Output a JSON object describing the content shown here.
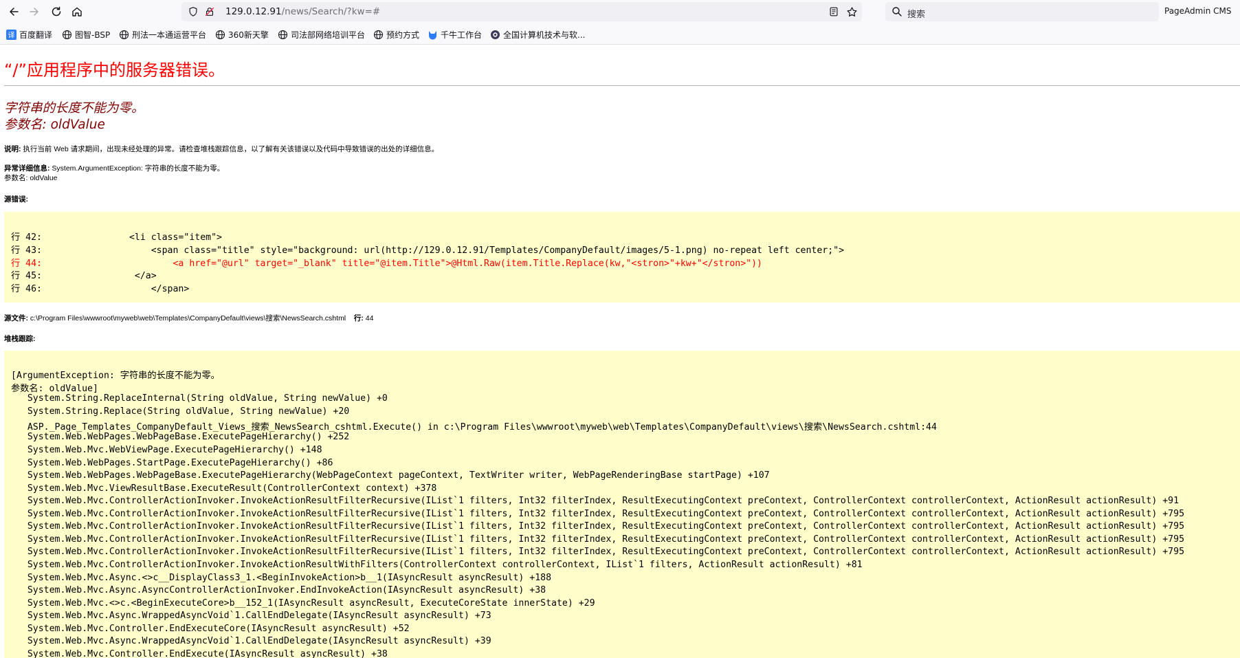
{
  "browser": {
    "url_host": "129.0.12.91",
    "url_path": "/news/Search/?kw=#",
    "search_placeholder": "搜索",
    "extension_label": "PageAdmin CMS"
  },
  "bookmarks": [
    {
      "label": "百度翻译",
      "icon": "translate-icon"
    },
    {
      "label": "图智-BSP",
      "icon": "globe-icon"
    },
    {
      "label": "刑法一本通运营平台",
      "icon": "globe-icon"
    },
    {
      "label": "360新天擎",
      "icon": "globe-icon"
    },
    {
      "label": "司法部网络培训平台",
      "icon": "globe-icon"
    },
    {
      "label": "预约方式",
      "icon": "globe-icon"
    },
    {
      "label": "千牛工作台",
      "icon": "qianniu-icon"
    },
    {
      "label": "全国计算机技术与软...",
      "icon": "eye-icon"
    }
  ],
  "page": {
    "title": "“/”应用程序中的服务器错误。",
    "message_line1": "字符串的长度不能为零。",
    "message_line2": "参数名: oldValue",
    "description_label": "说明:",
    "description_text": " 执行当前 Web 请求期间，出现未经处理的异常。请检查堆栈跟踪信息，以了解有关该错误以及代码中导致错误的出处的详细信息。",
    "exception_label": "异常详细信息:",
    "exception_text": " System.ArgumentException: 字符串的长度不能为零。",
    "exception_param": "参数名: oldValue",
    "source_error_label": "源错误:",
    "source_lines": [
      {
        "text": "行 42:                <li class=\"item\">",
        "highlight": false
      },
      {
        "text": "行 43:                    <span class=\"title\" style=\"background: url(http://129.0.12.91/Templates/CompanyDefault/images/5-1.png) no-repeat left center;\">",
        "highlight": false
      },
      {
        "text": "行 44:                        <a href=\"@url\" target=\"_blank\" title=\"@item.Title\">@Html.Raw(item.Title.Replace(kw,\"<stron>\"+kw+\"</stron>\"))",
        "highlight": true
      },
      {
        "text": "行 45:                 </a>",
        "highlight": false
      },
      {
        "text": "行 46:                    </span>",
        "highlight": false
      }
    ],
    "source_file_label": "源文件:",
    "source_file_path": " c:\\Program Files\\wwwroot\\myweb\\web\\Templates\\CompanyDefault\\views\\搜索\\NewsSearch.cshtml",
    "line_label": "行:",
    "line_value": " 44",
    "stack_label": "堆栈跟踪:",
    "stack_lines": [
      "[ArgumentException: 字符串的长度不能为零。",
      "参数名: oldValue]",
      "   System.String.ReplaceInternal(String oldValue, String newValue) +0",
      "   System.String.Replace(String oldValue, String newValue) +20",
      "   ASP._Page_Templates_CompanyDefault_Views_搜索_NewsSearch_cshtml.Execute() in c:\\Program Files\\wwwroot\\myweb\\web\\Templates\\CompanyDefault\\views\\搜索\\NewsSearch.cshtml:44",
      "   System.Web.WebPages.WebPageBase.ExecutePageHierarchy() +252",
      "   System.Web.Mvc.WebViewPage.ExecutePageHierarchy() +148",
      "   System.Web.WebPages.StartPage.ExecutePageHierarchy() +86",
      "   System.Web.WebPages.WebPageBase.ExecutePageHierarchy(WebPageContext pageContext, TextWriter writer, WebPageRenderingBase startPage) +107",
      "   System.Web.Mvc.ViewResultBase.ExecuteResult(ControllerContext context) +378",
      "   System.Web.Mvc.ControllerActionInvoker.InvokeActionResultFilterRecursive(IList`1 filters, Int32 filterIndex, ResultExecutingContext preContext, ControllerContext controllerContext, ActionResult actionResult) +91",
      "   System.Web.Mvc.ControllerActionInvoker.InvokeActionResultFilterRecursive(IList`1 filters, Int32 filterIndex, ResultExecutingContext preContext, ControllerContext controllerContext, ActionResult actionResult) +795",
      "   System.Web.Mvc.ControllerActionInvoker.InvokeActionResultFilterRecursive(IList`1 filters, Int32 filterIndex, ResultExecutingContext preContext, ControllerContext controllerContext, ActionResult actionResult) +795",
      "   System.Web.Mvc.ControllerActionInvoker.InvokeActionResultFilterRecursive(IList`1 filters, Int32 filterIndex, ResultExecutingContext preContext, ControllerContext controllerContext, ActionResult actionResult) +795",
      "   System.Web.Mvc.ControllerActionInvoker.InvokeActionResultFilterRecursive(IList`1 filters, Int32 filterIndex, ResultExecutingContext preContext, ControllerContext controllerContext, ActionResult actionResult) +795",
      "   System.Web.Mvc.ControllerActionInvoker.InvokeActionResultWithFilters(ControllerContext controllerContext, IList`1 filters, ActionResult actionResult) +81",
      "   System.Web.Mvc.Async.<>c__DisplayClass3_1.<BeginInvokeAction>b__1(IAsyncResult asyncResult) +188",
      "   System.Web.Mvc.Async.AsyncControllerActionInvoker.EndInvokeAction(IAsyncResult asyncResult) +38",
      "   System.Web.Mvc.<>c.<BeginExecuteCore>b__152_1(IAsyncResult asyncResult, ExecuteCoreState innerState) +29",
      "   System.Web.Mvc.Async.WrappedAsyncVoid`1.CallEndDelegate(IAsyncResult asyncResult) +73",
      "   System.Web.Mvc.Controller.EndExecuteCore(IAsyncResult asyncResult) +52",
      "   System.Web.Mvc.Async.WrappedAsyncVoid`1.CallEndDelegate(IAsyncResult asyncResult) +39",
      "   System.Web.Mvc.Controller.EndExecute(IAsyncResult asyncResult) +38"
    ]
  },
  "colors": {
    "error_title": "#ff0000",
    "error_message": "#800000",
    "code_background": "#ffffcc",
    "highlight_line": "#ff0000"
  }
}
